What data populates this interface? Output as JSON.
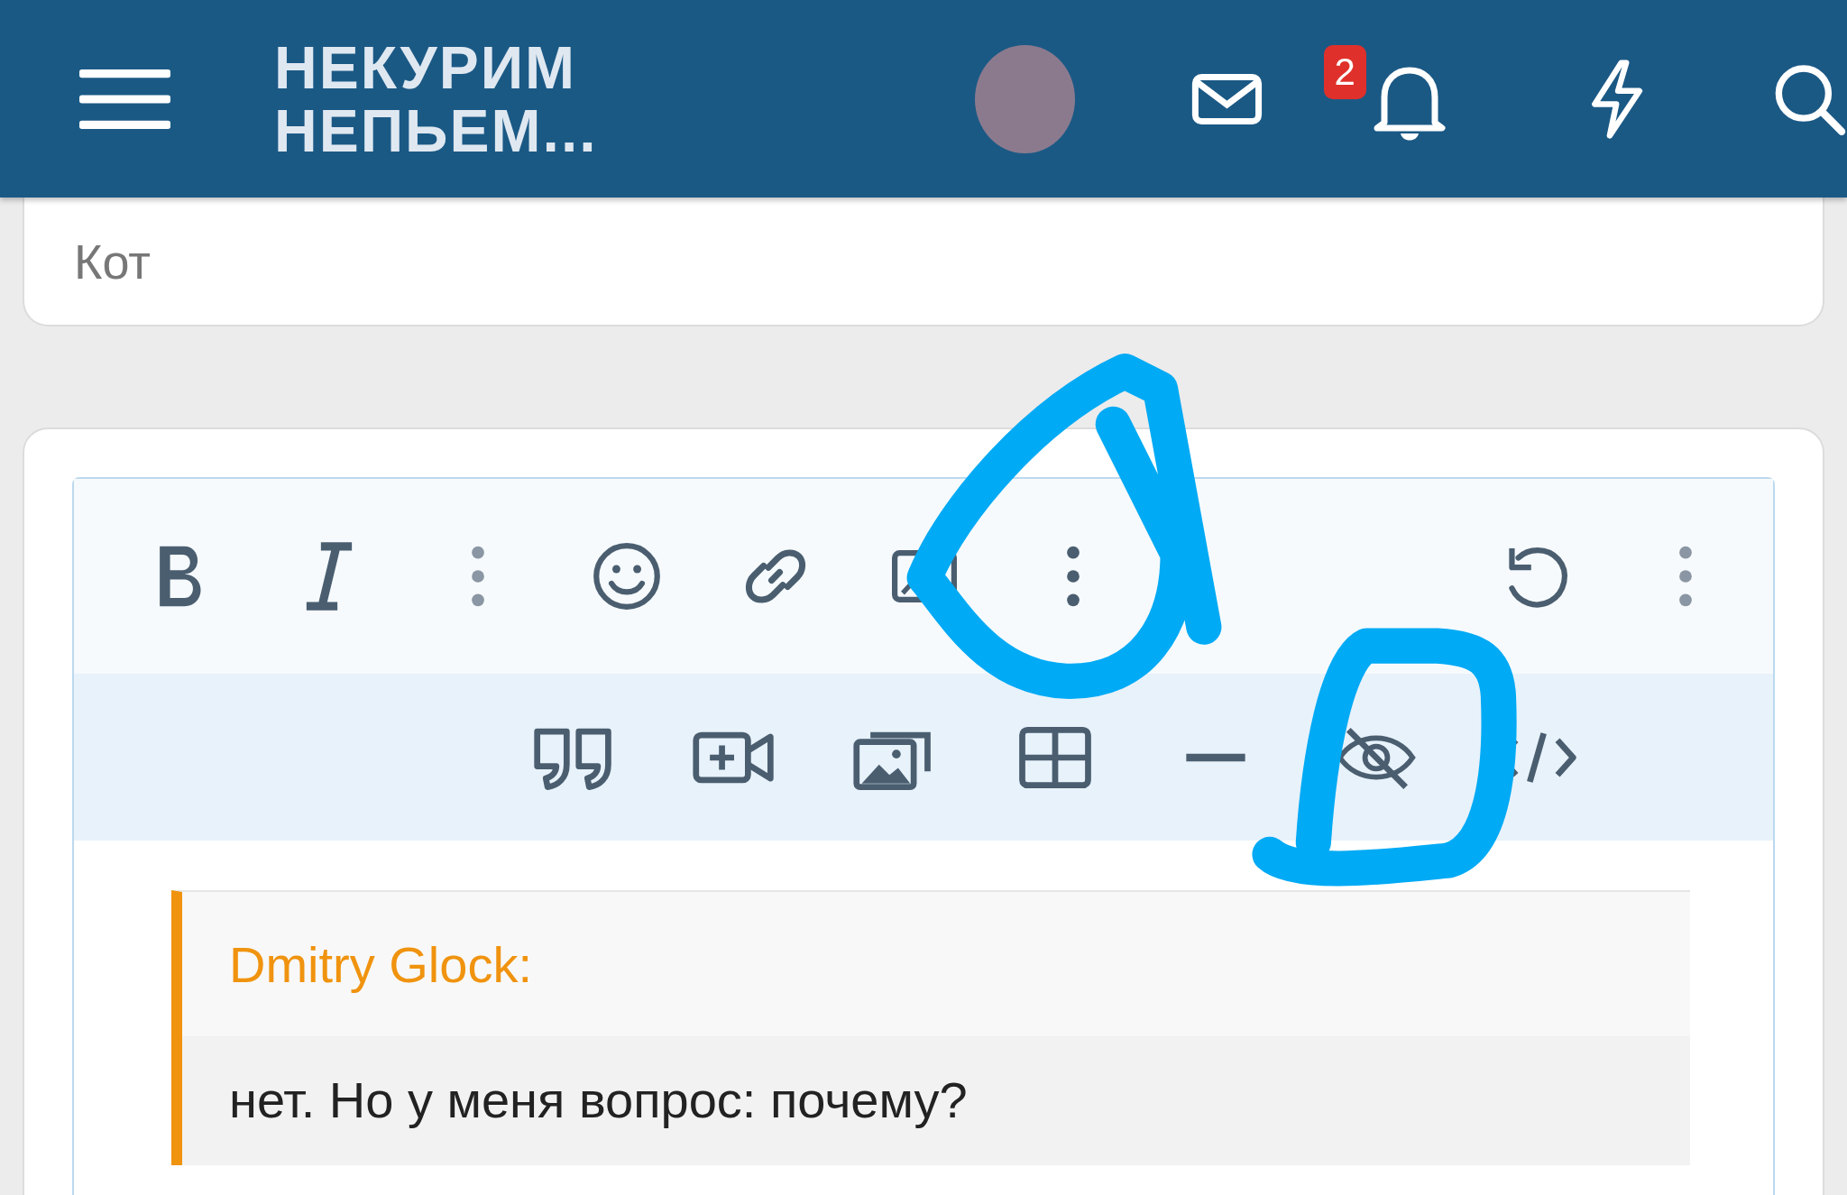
{
  "header": {
    "logo_lines": [
      "НЕКУРИМ",
      "НЕПЬЕМ..."
    ],
    "notification_count": "2"
  },
  "previous_post": {
    "text": "Кот"
  },
  "quote": {
    "author": "Dmitry Glock:",
    "text": "нет. Но у меня вопрос: почему?"
  }
}
